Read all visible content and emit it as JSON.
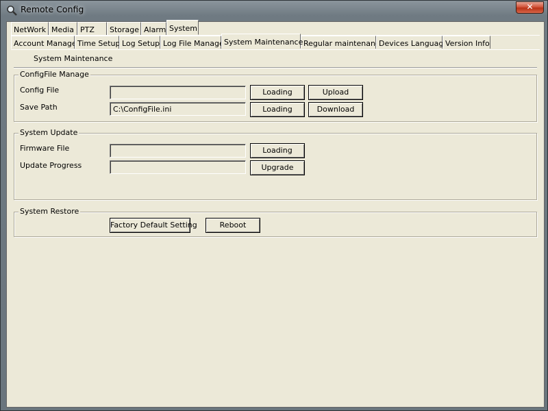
{
  "window": {
    "title": "Remote Config",
    "close_label": "✕"
  },
  "tabs_main": [
    "NetWork",
    "Media",
    "PTZ",
    "Storage",
    "Alarm",
    "System"
  ],
  "tabs_main_active": 5,
  "tabs_sub": [
    "Account Manage",
    "Time Setup",
    "Log Setup",
    "Log File Manage",
    "System Maintenance",
    "Regular maintenance",
    "Devices Language",
    "Version Info"
  ],
  "tabs_sub_active": 4,
  "panel_caption": "System Maintenance",
  "config_group": {
    "legend": "ConfigFile Manage",
    "config_file_label": "Config File",
    "config_file_value": "",
    "save_path_label": "Save Path",
    "save_path_value": "C:\\ConfigFile.ini",
    "loading_label": "Loading",
    "upload_label": "Upload",
    "download_label": "Download"
  },
  "update_group": {
    "legend": "System Update",
    "firmware_label": "Firmware File",
    "firmware_value": "",
    "progress_label": "Update Progress",
    "progress_value": "",
    "loading_label": "Loading",
    "upgrade_label": "Upgrade"
  },
  "restore_group": {
    "legend": "System Restore",
    "factory_label": "Factory Default Setting",
    "reboot_label": "Reboot"
  },
  "colors": {
    "face": "#ece9d8",
    "close": "#c8442a"
  },
  "icons": {
    "app": "magnifier-icon",
    "close": "close-icon"
  }
}
